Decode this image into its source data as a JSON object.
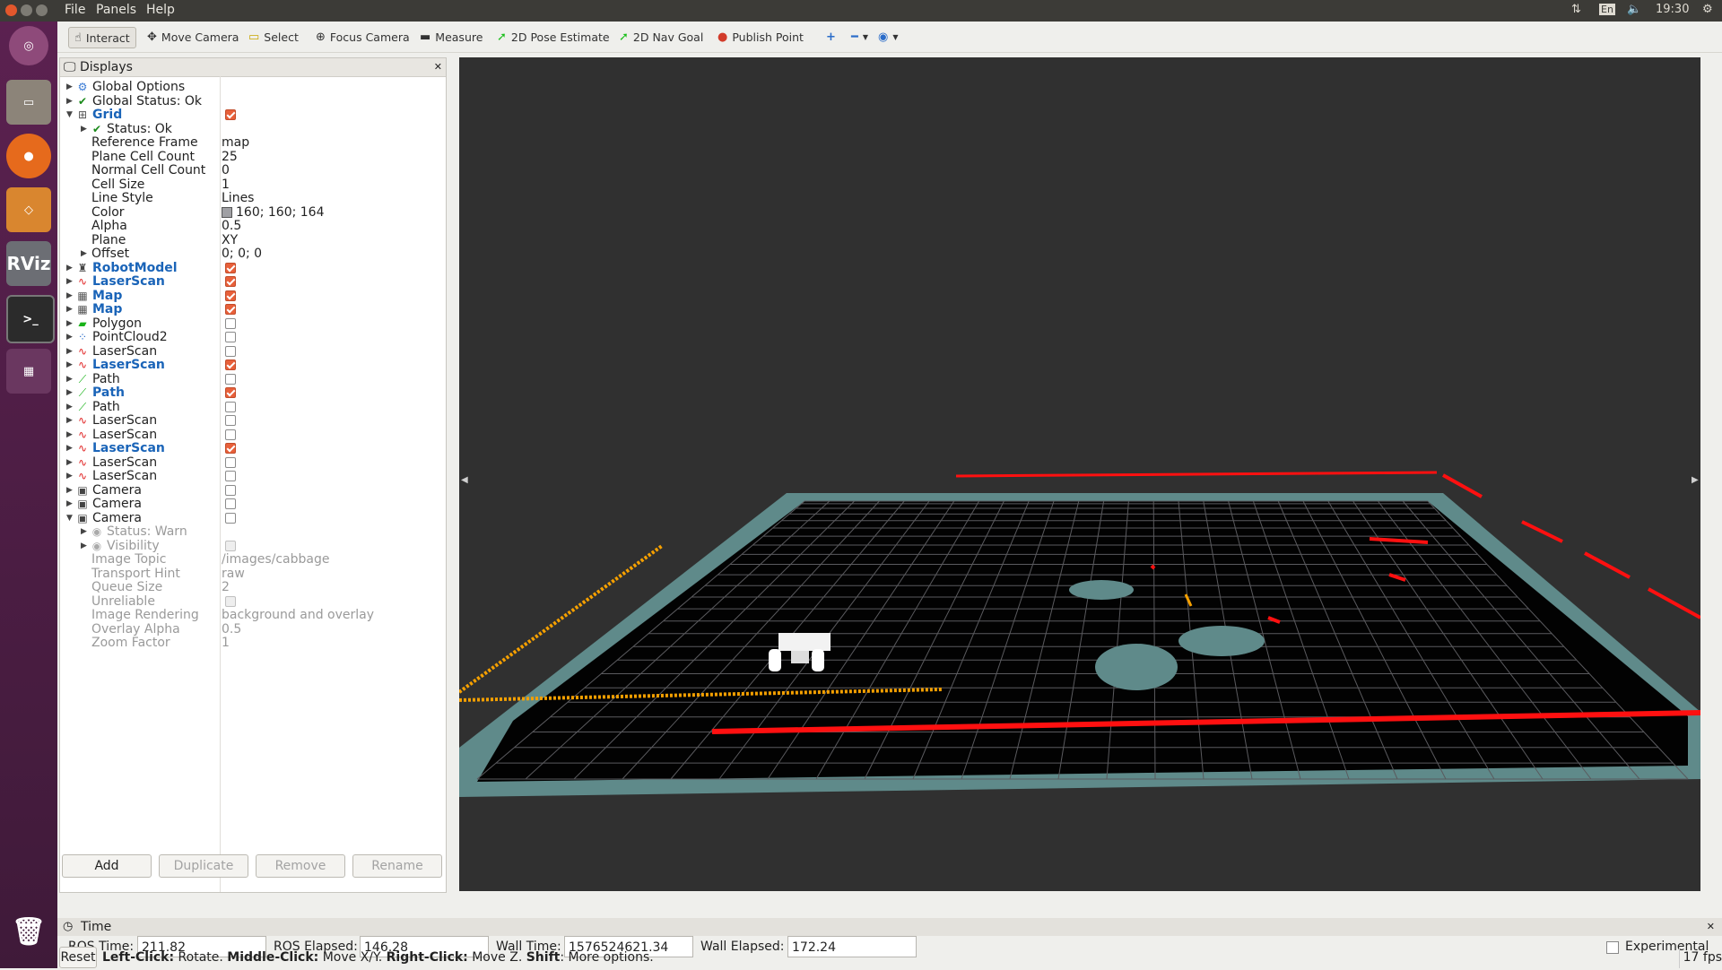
{
  "menubar": {
    "items": [
      "File",
      "Panels",
      "Help"
    ],
    "clock": "19:30",
    "lang": "En"
  },
  "toolbar": {
    "tools": [
      "Interact",
      "Move Camera",
      "Select",
      "Focus Camera",
      "Measure",
      "2D Pose Estimate",
      "2D Nav Goal",
      "Publish Point"
    ]
  },
  "displays": {
    "title": "Displays",
    "rows": [
      {
        "d": 0,
        "exp": "▶",
        "icon": "gear-icon",
        "label": "Global Options"
      },
      {
        "d": 0,
        "exp": "▶",
        "icon": "check-icon",
        "label": "Global Status: Ok"
      },
      {
        "d": 0,
        "exp": "▼",
        "icon": "grid-icon",
        "label": "Grid",
        "blue": true,
        "cb": "on"
      },
      {
        "d": 1,
        "exp": "▶",
        "icon": "check-icon",
        "label": "Status: Ok"
      },
      {
        "d": 1,
        "label": "Reference Frame",
        "value": "map"
      },
      {
        "d": 1,
        "label": "Plane Cell Count",
        "value": "25"
      },
      {
        "d": 1,
        "label": "Normal Cell Count",
        "value": "0"
      },
      {
        "d": 1,
        "label": "Cell Size",
        "value": "1"
      },
      {
        "d": 1,
        "label": "Line Style",
        "value": "Lines"
      },
      {
        "d": 1,
        "label": "Color",
        "value": "160; 160; 164",
        "swatch": "#a0a0a4"
      },
      {
        "d": 1,
        "label": "Alpha",
        "value": "0.5"
      },
      {
        "d": 1,
        "label": "Plane",
        "value": "XY"
      },
      {
        "d": 1,
        "exp": "▶",
        "label": "Offset",
        "value": "0; 0; 0"
      },
      {
        "d": 0,
        "exp": "▶",
        "icon": "robot-icon",
        "label": "RobotModel",
        "blue": true,
        "cb": "on"
      },
      {
        "d": 0,
        "exp": "▶",
        "icon": "laserscan-icon",
        "label": "LaserScan",
        "blue": true,
        "cb": "on"
      },
      {
        "d": 0,
        "exp": "▶",
        "icon": "map-icon",
        "label": "Map",
        "blue": true,
        "cb": "on"
      },
      {
        "d": 0,
        "exp": "▶",
        "icon": "map-icon",
        "label": "Map",
        "blue": true,
        "cb": "on"
      },
      {
        "d": 0,
        "exp": "▶",
        "icon": "polygon-icon",
        "label": "Polygon",
        "cb": "off"
      },
      {
        "d": 0,
        "exp": "▶",
        "icon": "pointcloud-icon",
        "label": "PointCloud2",
        "cb": "off"
      },
      {
        "d": 0,
        "exp": "▶",
        "icon": "laserscan-icon",
        "label": "LaserScan",
        "cb": "off"
      },
      {
        "d": 0,
        "exp": "▶",
        "icon": "laserscan-icon",
        "label": "LaserScan",
        "blue": true,
        "cb": "on"
      },
      {
        "d": 0,
        "exp": "▶",
        "icon": "path-icon",
        "label": "Path",
        "cb": "off"
      },
      {
        "d": 0,
        "exp": "▶",
        "icon": "path-icon",
        "label": "Path",
        "blue": true,
        "cb": "on"
      },
      {
        "d": 0,
        "exp": "▶",
        "icon": "path-icon",
        "label": "Path",
        "cb": "off"
      },
      {
        "d": 0,
        "exp": "▶",
        "icon": "laserscan-icon",
        "label": "LaserScan",
        "cb": "off"
      },
      {
        "d": 0,
        "exp": "▶",
        "icon": "laserscan-icon",
        "label": "LaserScan",
        "cb": "off"
      },
      {
        "d": 0,
        "exp": "▶",
        "icon": "laserscan-icon",
        "label": "LaserScan",
        "blue": true,
        "cb": "on"
      },
      {
        "d": 0,
        "exp": "▶",
        "icon": "laserscan-icon",
        "label": "LaserScan",
        "cb": "off"
      },
      {
        "d": 0,
        "exp": "▶",
        "icon": "laserscan-icon",
        "label": "LaserScan",
        "cb": "off"
      },
      {
        "d": 0,
        "exp": "▶",
        "icon": "camera-icon",
        "label": "Camera",
        "cb": "off"
      },
      {
        "d": 0,
        "exp": "▶",
        "icon": "camera-icon",
        "label": "Camera",
        "cb": "off"
      },
      {
        "d": 0,
        "exp": "▼",
        "icon": "camera-icon",
        "label": "Camera",
        "cb": "off"
      },
      {
        "d": 1,
        "exp": "▶",
        "icon": "warn-icon",
        "label": "Status: Warn",
        "grey": true
      },
      {
        "d": 1,
        "exp": "▶",
        "icon": "eye-icon",
        "label": "Visibility",
        "grey": true,
        "cb": "dis"
      },
      {
        "d": 1,
        "label": "Image Topic",
        "value": "/images/cabbage",
        "grey": true
      },
      {
        "d": 1,
        "label": "Transport Hint",
        "value": "raw",
        "grey": true
      },
      {
        "d": 1,
        "label": "Queue Size",
        "value": "2",
        "grey": true
      },
      {
        "d": 1,
        "label": "Unreliable",
        "grey": true,
        "cb": "dis"
      },
      {
        "d": 1,
        "label": "Image Rendering",
        "value": "background and overlay",
        "grey": true
      },
      {
        "d": 1,
        "label": "Overlay Alpha",
        "value": "0.5",
        "grey": true
      },
      {
        "d": 1,
        "label": "Zoom Factor",
        "value": "1",
        "grey": true
      }
    ],
    "buttons": {
      "add": "Add",
      "duplicate": "Duplicate",
      "remove": "Remove",
      "rename": "Rename"
    }
  },
  "time": {
    "title": "Time",
    "ros_time_label": "ROS Time:",
    "ros_time": "211.82",
    "ros_elapsed_label": "ROS Elapsed:",
    "ros_elapsed": "146.28",
    "wall_time_label": "Wall Time:",
    "wall_time": "1576524621.34",
    "wall_elapsed_label": "Wall Elapsed:",
    "wall_elapsed": "172.24",
    "experimental": "Experimental"
  },
  "status": {
    "reset": "Reset",
    "k1": "Left-Click:",
    "v1": " Rotate. ",
    "k2": "Middle-Click:",
    "v2": " Move X/Y. ",
    "k3": "Right-Click:",
    "v3": " Move Z. ",
    "k4": "Shift",
    "v4": ": More options.",
    "fps": "17 fps"
  },
  "colors": {
    "laser_red": "#ff1010",
    "path_orange": "#f5a000",
    "map_teal": "#5f8a8a",
    "checkbox_on": "#e8603a",
    "link_blue": "#1a64b8"
  }
}
